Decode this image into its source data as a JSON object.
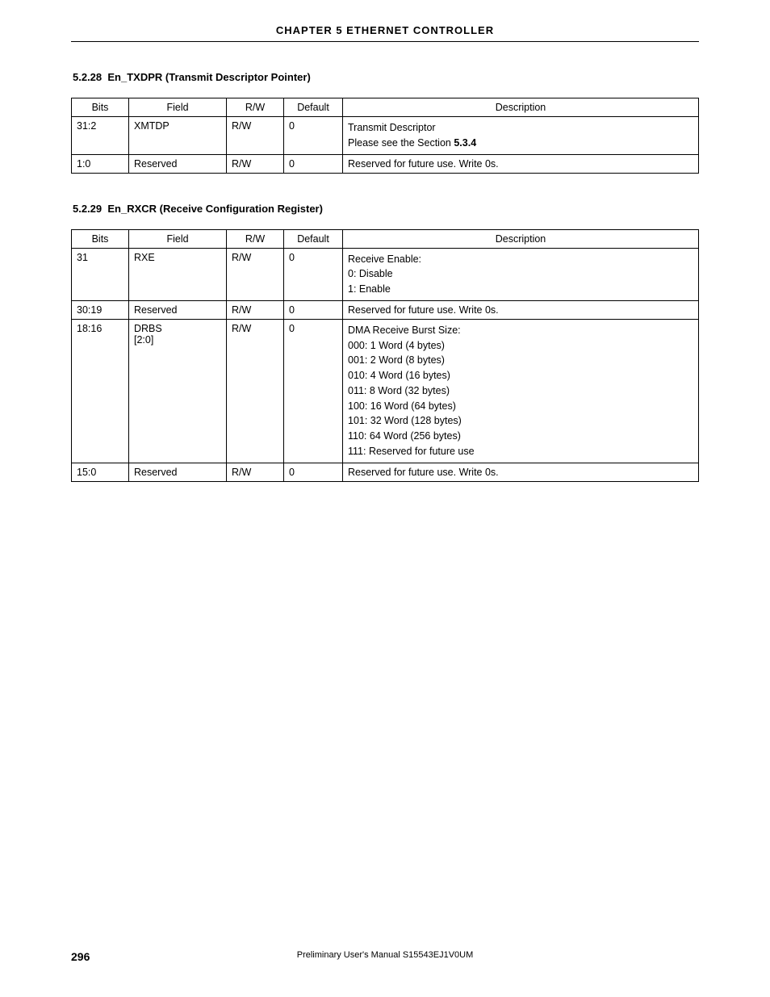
{
  "chapter_header": "CHAPTER  5   ETHERNET  CONTROLLER",
  "section1": {
    "number": "5.2.28",
    "title": "En_TXDPR (Transmit Descriptor Pointer)"
  },
  "section2": {
    "number": "5.2.29",
    "title": "En_RXCR (Receive Configuration Register)"
  },
  "headers": {
    "bits": "Bits",
    "field": "Field",
    "rw": "R/W",
    "default": "Default",
    "description": "Description"
  },
  "table1": {
    "rows": [
      {
        "bits": "31:2",
        "field": "XMTDP",
        "rw": "R/W",
        "default": "0",
        "desc_prefix": "Transmit Descriptor",
        "desc_line2a": "Please see the Section ",
        "desc_line2b": "5.3.4"
      },
      {
        "bits": "1:0",
        "field": "Reserved",
        "rw": "R/W",
        "default": "0",
        "desc": "Reserved for future use. Write 0s."
      }
    ]
  },
  "table2": {
    "rows": [
      {
        "bits": "31",
        "field": "RXE",
        "rw": "R/W",
        "default": "0",
        "desc_lines": [
          "Receive Enable:",
          "0: Disable",
          "1: Enable"
        ]
      },
      {
        "bits": "30:19",
        "field": "Reserved",
        "rw": "R/W",
        "default": "0",
        "desc_lines": [
          "Reserved for future use. Write 0s."
        ]
      },
      {
        "bits": "18:16",
        "field": "DRBS",
        "field2": "[2:0]",
        "rw": "R/W",
        "default": "0",
        "desc_lines": [
          "DMA Receive Burst Size:",
          "000: 1 Word (4 bytes)",
          "001: 2 Word (8 bytes)",
          "010: 4 Word (16 bytes)",
          "011: 8 Word (32 bytes)",
          "100: 16 Word (64 bytes)",
          "101: 32 Word (128 bytes)",
          "110: 64 Word (256 bytes)",
          "111: Reserved for future use"
        ]
      },
      {
        "bits": "15:0",
        "field": "Reserved",
        "rw": "R/W",
        "default": "0",
        "desc_lines": [
          "Reserved for future use. Write 0s."
        ]
      }
    ]
  },
  "footer": {
    "page": "296",
    "doc": "Preliminary User's Manual  S15543EJ1V0UM"
  }
}
